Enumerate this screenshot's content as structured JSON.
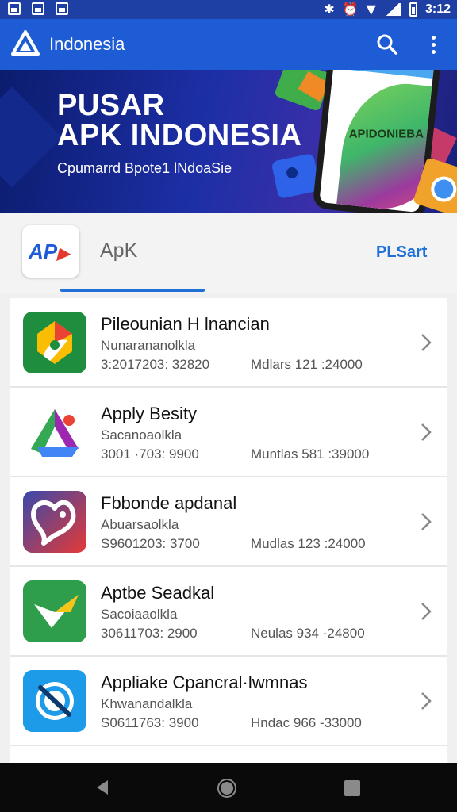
{
  "status_bar": {
    "time": "3:12",
    "left_icons": [
      "image-icon",
      "sync-icon",
      "photo-icon"
    ],
    "right_icons": [
      "bluetooth-icon",
      "alarm-icon",
      "wifi-icon",
      "signal-icon",
      "battery-icon"
    ]
  },
  "app_bar": {
    "title": "Indonesia",
    "logo_icon": "triangle-logo-icon",
    "actions": [
      "search-icon",
      "more-vert-icon"
    ]
  },
  "banner": {
    "title_line1": "PUSAR",
    "title_line2": "APK INDONESIA",
    "subtitle": "Cpumarrd Bpote1 lNdoaSie",
    "phone_text": "APIDONIEBA"
  },
  "tabs": {
    "logo_text_a": "AP",
    "logo_text_b": "▶",
    "apk_label": "ApK",
    "right_label": "PLSart",
    "active_index": 0
  },
  "apps": [
    {
      "title": "Pileounian H lnancian",
      "subtitle": "Nunarananolkla",
      "meta_left": "3:2017203: 32820",
      "meta_right": "Mdlars 121 :24000",
      "icon": "play-store-like-icon",
      "colors": [
        "#1e8e3e",
        "#fbbc04",
        "#ea4335",
        "#ffffff"
      ]
    },
    {
      "title": "Apply Besity",
      "subtitle": "Sacanoaolkla",
      "meta_left": "3001 ·703: 9900",
      "meta_right": "Muntlas 581 :39000",
      "icon": "drive-like-icon",
      "colors": [
        "#34a853",
        "#4285f4",
        "#ea4335",
        "#9c27b0"
      ]
    },
    {
      "title": "Fbbonde apdanal",
      "subtitle": "Abuarsaolkla",
      "meta_left": "S9601203: 3700",
      "meta_right": "Mudlas 123 :24000",
      "icon": "heart-chat-icon",
      "colors": [
        "#e53935",
        "#3949ab",
        "#ffffff"
      ]
    },
    {
      "title": "Aptbe Seadkal",
      "subtitle": "Sacoiaaolkla",
      "meta_left": "30611703: 2900",
      "meta_right": "Neulas 934 -24800",
      "icon": "check-mark-icon",
      "colors": [
        "#2e9e4c",
        "#f5c518",
        "#ffffff"
      ]
    },
    {
      "title": "Appliake Cpancral·lwmnas",
      "subtitle": "Khwanandalkla",
      "meta_left": "S0611763: 3900",
      "meta_right": "Hndac 966 -33000",
      "icon": "blocked-circle-icon",
      "colors": [
        "#1e9be8",
        "#ffffff",
        "#0b3b6e"
      ]
    }
  ],
  "nav_bar": {
    "buttons": [
      "back-icon",
      "home-icon",
      "recents-icon"
    ]
  }
}
